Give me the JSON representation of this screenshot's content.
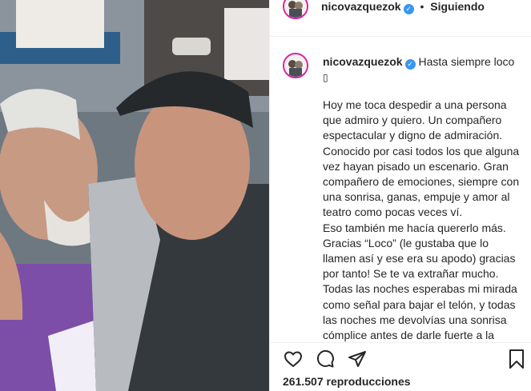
{
  "post": {
    "username": "nicovazquezok",
    "follow_status": "Siguiendo",
    "header_separator": "•",
    "caption_first_line": "Hasta siempre loco",
    "caption_emoji": "▯",
    "caption_body": "Hoy me toca despedir a una persona que admiro y quiero. Un compañero espectacular y digno de admiración. Conocido por casi todos los que alguna vez hayan pisado un escenario. Gran compañero de emociones, siempre con una sonrisa, ganas, empuje y amor al teatro como pocas veces ví.\nEso también me hacía quererlo más. Gracias “Loco” (le gustaba que lo llamen así y ese era su apodo) gracias por tanto! Se te va extrañar mucho.\nTodas las noches esperabas mi mirada como señal para bajar el telón, y todas las noches me devolvías una sonrisa cómplice antes de darle fuerte a la",
    "views": "261.507 reproducciones"
  },
  "icons": {
    "verified": "verified-badge-icon",
    "like": "heart-icon",
    "comment": "comment-icon",
    "share": "paper-plane-icon",
    "save": "bookmark-icon"
  },
  "colors": {
    "verified": "#3897f0",
    "text": "#262626",
    "story_ring": "#d6249f"
  }
}
